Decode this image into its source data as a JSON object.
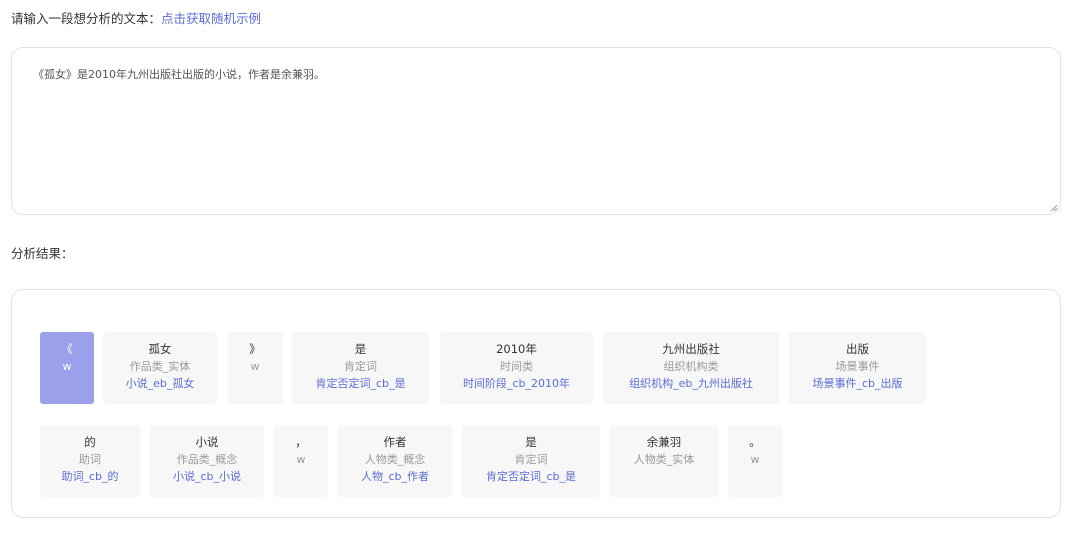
{
  "prompt": {
    "label": "请输入一段想分析的文本：",
    "random_link": "点击获取随机示例"
  },
  "input_text": "《孤女》是2010年九州出版社出版的小说，作者是余兼羽。",
  "result_label": "分析结果：",
  "tokens": [
    {
      "word": "《",
      "cat": "w",
      "ent": "",
      "selected": true
    },
    {
      "word": "孤女",
      "cat": "作品类_实体",
      "ent": "小说_eb_孤女"
    },
    {
      "word": "》",
      "cat": "w",
      "ent": ""
    },
    {
      "word": "是",
      "cat": "肯定词",
      "ent": "肯定否定词_cb_是"
    },
    {
      "word": "2010年",
      "cat": "时间类",
      "ent": "时间阶段_cb_2010年"
    },
    {
      "word": "九州出版社",
      "cat": "组织机构类",
      "ent": "组织机构_eb_九州出版社"
    },
    {
      "word": "出版",
      "cat": "场景事件",
      "ent": "场景事件_cb_出版"
    },
    {
      "word": "的",
      "cat": "助词",
      "ent": "助词_cb_的"
    },
    {
      "word": "小说",
      "cat": "作品类_概念",
      "ent": "小说_cb_小说"
    },
    {
      "word": "，",
      "cat": "w",
      "ent": ""
    },
    {
      "word": "作者",
      "cat": "人物类_概念",
      "ent": "人物_cb_作者"
    },
    {
      "word": "是",
      "cat": "肯定词",
      "ent": "肯定否定词_cb_是"
    },
    {
      "word": "余兼羽",
      "cat": "人物类_实体",
      "ent": ""
    },
    {
      "word": "。",
      "cat": "w",
      "ent": ""
    }
  ],
  "colors": {
    "link": "#5b6cd6",
    "selected_bg": "#9aa0ea",
    "token_bg": "#f7f7f7"
  }
}
